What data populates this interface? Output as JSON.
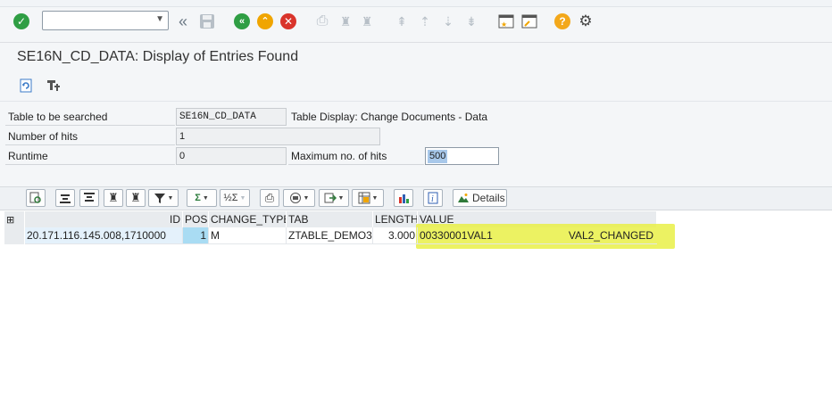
{
  "window": {
    "title": "SE16N_CD_DATA: Display of Entries Found"
  },
  "command_field": {
    "value": "",
    "placeholder": ""
  },
  "app_toolbar": {
    "icons": [
      "refresh-icon",
      "settings-tool-icon"
    ]
  },
  "form": {
    "table_label": "Table to be searched",
    "table_value": "SE16N_CD_DATA",
    "table_desc": "Table Display: Change Documents - Data",
    "hits_label": "Number of hits",
    "hits_value": "1",
    "runtime_label": "Runtime",
    "runtime_value": "0",
    "max_hits_label": "Maximum no. of hits",
    "max_hits_value": "500"
  },
  "alv_toolbar": {
    "details_label": "Details",
    "sum_symbol": "Σ"
  },
  "grid": {
    "columns": [
      "ID",
      "POS",
      "CHANGE_TYPE",
      "TAB",
      "LENGTH",
      "VALUE"
    ],
    "rows": [
      {
        "id": "20.171.116.145.008,1710000",
        "pos": "1",
        "change_type": "M",
        "tab": "ZTABLE_DEMO3",
        "length": "3.000",
        "value_left": "00330001VAL1",
        "value_right": "VAL2_CHANGED"
      }
    ]
  },
  "colors": {
    "highlight": "#e9f046",
    "accent": "#2f9e44",
    "warning": "#f0a500",
    "error": "#d9342b",
    "help": "#f3a81b"
  }
}
